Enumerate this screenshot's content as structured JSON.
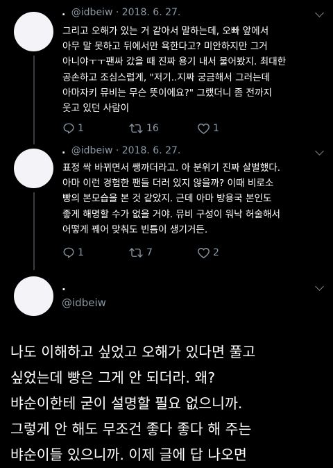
{
  "tweets": [
    {
      "name": ".",
      "handle": "@idbeiw",
      "separator": "·",
      "date": "2018. 6. 27.",
      "text": "그리고 오해가 있는 거 같아서 말하는데, 오빠 앞에서\n아무 말 못하고 뒤에서만 욕한다고? 미안하지만 그거\n아니야ㅜㅜ팬싸 갔을 때 진짜 용기 내서 물어봤지. 최대한\n공손하고 조심스럽게, \"저기..지짜 궁금해서 그러는데\n아마자키 뮤비는 무슨 뜻이에요?\" 그랬더니 좀 전까지\n웃고 있던 사람이",
      "replies": "1",
      "retweets": "16",
      "likes": "1"
    },
    {
      "name": ".",
      "handle": "@idbeiw",
      "separator": "·",
      "date": "2018. 6. 27.",
      "text": "표정 싹 바뀌면서 쌩까더라고. 아 분위기 진짜 살벌했다.\n아마 이런 경험한 팬들 더러 있지 않을까? 이때 비로소\n빵의 본모습을 본 것 같았지. 근데 아마 방용국 본인도\n좋게 해명할 수가 없을 거야. 뮤비 구성이 워낙 허술해서\n어떻게 꿰어 맞춰도 빈틈이 생기거든.",
      "replies": "1",
      "retweets": "7",
      "likes": "2"
    }
  ],
  "main_tweet": {
    "name": ".",
    "handle": "@idbeiw",
    "text": "나도 이해하고 싶었고 오해가 있다면 풀고\n싶었는데 빵은 그게 안 되더라. 왜?\n뱌순이한테 굳이 설명할 필요 없으니까.\n그렇게 안 해도 무조건 좋다 좋다 해 주는\n뱌순이들 있으니까. 이제 글에 답 나오면"
  },
  "icons": {
    "reply": "reply-icon",
    "retweet": "retweet-icon",
    "like": "heart-icon",
    "more": "chevron-down-icon"
  },
  "colors": {
    "background": "#000000",
    "text": "#ffffff",
    "secondary": "#8b98a5",
    "avatar": "#f3f3f8",
    "divider": "#2f3336"
  }
}
